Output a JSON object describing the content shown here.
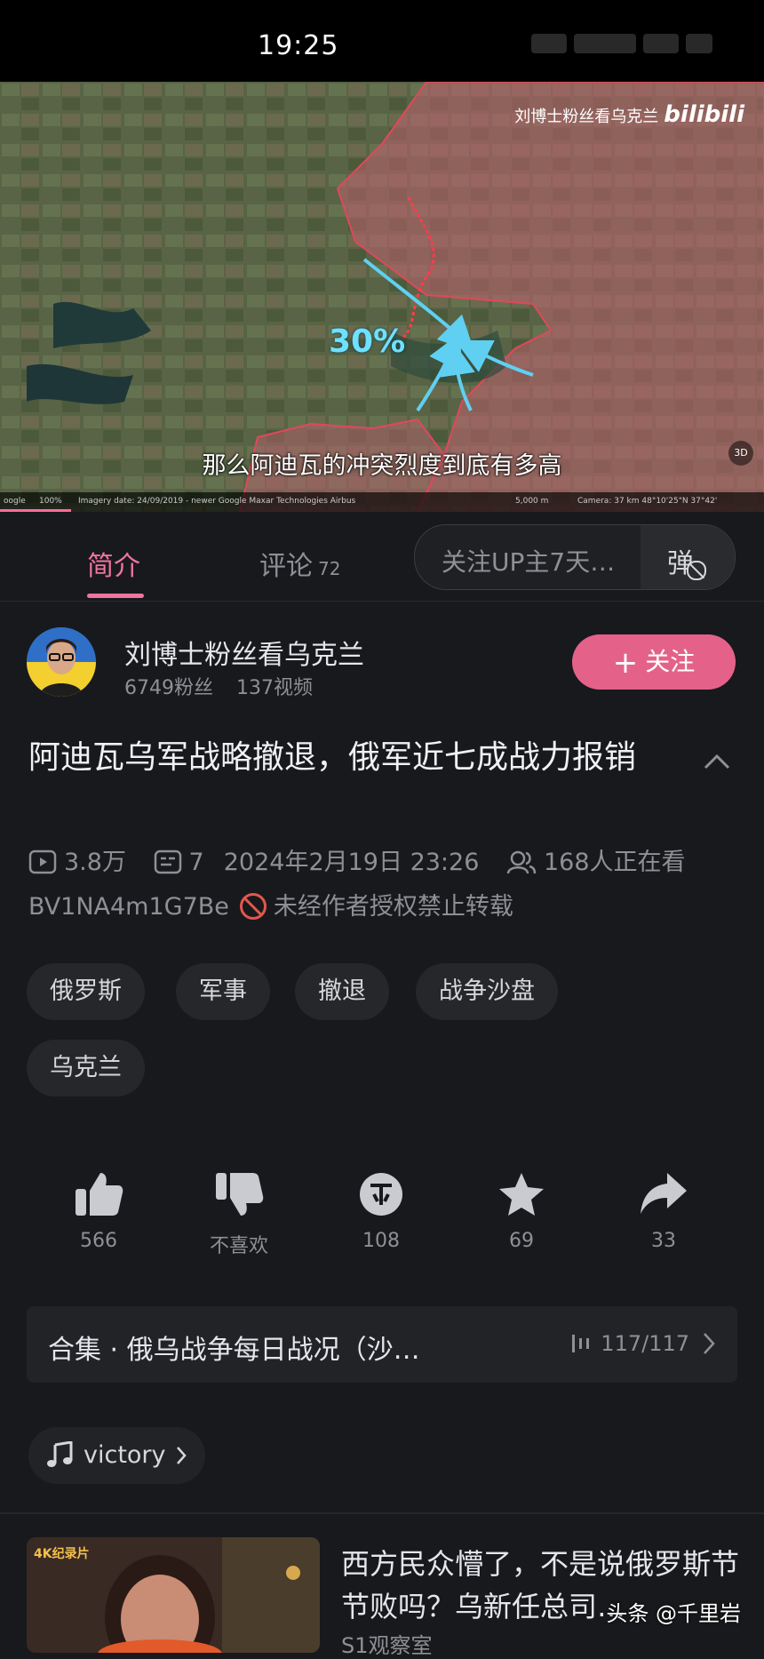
{
  "status_bar": {
    "time": "19:25"
  },
  "video": {
    "watermark_channel": "刘博士粉丝看乌克兰",
    "watermark_brand": "bilibili",
    "overlay_percent": "30%",
    "subtitle": "那么阿迪瓦的冲突烈度到底有多高",
    "map_attribution": "Imagery date: 24/09/2019 - newer    Google   Maxar Technologies   Airbus",
    "map_scale": "5,000 m",
    "map_camera": "Camera: 37 km  48°10'25\"N 37°42'",
    "map_logo": "oogle",
    "map_zoom": "100%",
    "map_3d": "3D",
    "territory_color": "#c0606f",
    "arrow_color": "#5fd0f2"
  },
  "tabs": {
    "intro_label": "简介",
    "comments_label": "评论",
    "comments_count": "72",
    "follow_banner": "关注UP主7天…",
    "danmu_label": "弹",
    "accent_color": "#f0749e"
  },
  "uploader": {
    "name": "刘博士粉丝看乌克兰",
    "followers": "6749粉丝",
    "videos": "137视频",
    "follow_label": "关注",
    "follow_plus": "+"
  },
  "video_info": {
    "title": "阿迪瓦乌军战略撤退，俄军近七成战力报销",
    "views": "3.8万",
    "danmaku_count": "7",
    "publish_time": "2024年2月19日 23:26",
    "watching": "168人正在看",
    "bvid": "BV1NA4m1G7Be",
    "copyright_notice": "未经作者授权禁止转载"
  },
  "tags": [
    "俄罗斯",
    "军事",
    "撤退",
    "战争沙盘",
    "乌克兰"
  ],
  "actions": {
    "like": "566",
    "dislike": "不喜欢",
    "coin": "108",
    "favorite": "69",
    "share": "33"
  },
  "collection": {
    "title": "合集 · 俄乌战争每日战况（沙…",
    "progress": "117/117"
  },
  "music": {
    "title": "victory"
  },
  "recommendation": {
    "thumb_label": "4K纪录片",
    "title": "西方民众懵了，不是说俄罗斯节节败吗？乌新任总司…",
    "channel": "S1观察室"
  },
  "source_watermark": "头条 @千里岩"
}
